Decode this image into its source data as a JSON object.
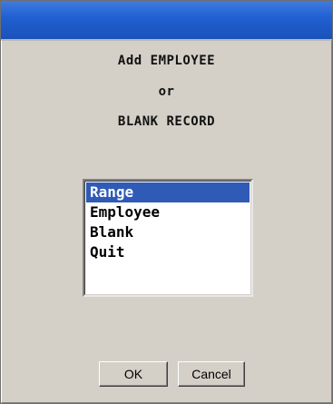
{
  "dialog": {
    "message_lines": [
      "Add EMPLOYEE",
      "or",
      "BLANK RECORD"
    ]
  },
  "listbox": {
    "items": [
      "Range",
      "Employee",
      "Blank",
      "Quit"
    ],
    "selected_item": "Range"
  },
  "buttons": {
    "ok_label": "OK",
    "cancel_label": "Cancel"
  },
  "colors": {
    "titlebar": "#1f5fd0",
    "background": "#d4d0c8",
    "selection": "#2f5bb7"
  }
}
